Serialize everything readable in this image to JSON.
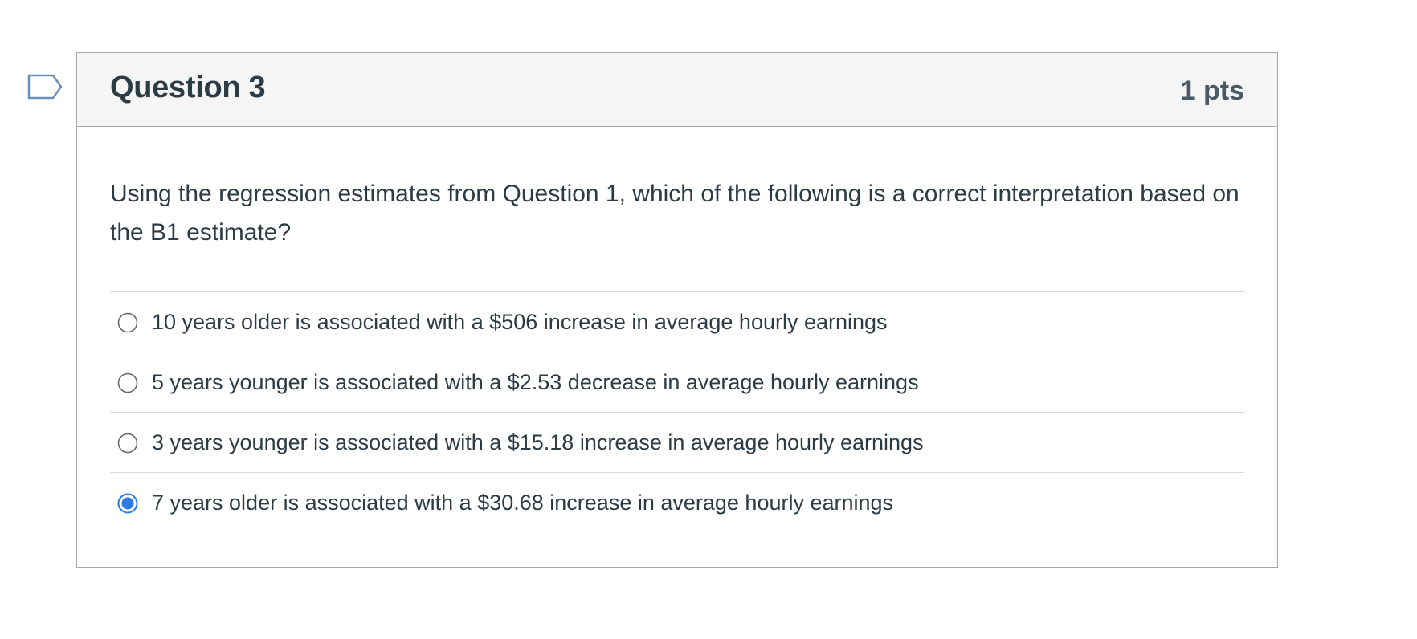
{
  "question": {
    "title": "Question 3",
    "points": "1 pts",
    "text": "Using the regression estimates from Question 1, which of the following is a correct interpretation based on the B1 estimate?",
    "flag_icon": "flag-outline-icon"
  },
  "answers": [
    {
      "label": "10 years older is associated with a $506 increase in average hourly earnings",
      "selected": false
    },
    {
      "label": "5 years younger is associated with a $2.53 decrease in average hourly earnings",
      "selected": false
    },
    {
      "label": "3 years younger is associated with a $15.18 increase in average hourly earnings",
      "selected": false
    },
    {
      "label": "7 years older is associated with a $30.68 increase in average hourly earnings",
      "selected": true
    }
  ],
  "colors": {
    "radio_selected": "#2b7be5",
    "radio_border": "#666666",
    "header_bg": "#f5f5f5",
    "text": "#2d3b45",
    "flag_stroke": "#6a8fb8"
  }
}
